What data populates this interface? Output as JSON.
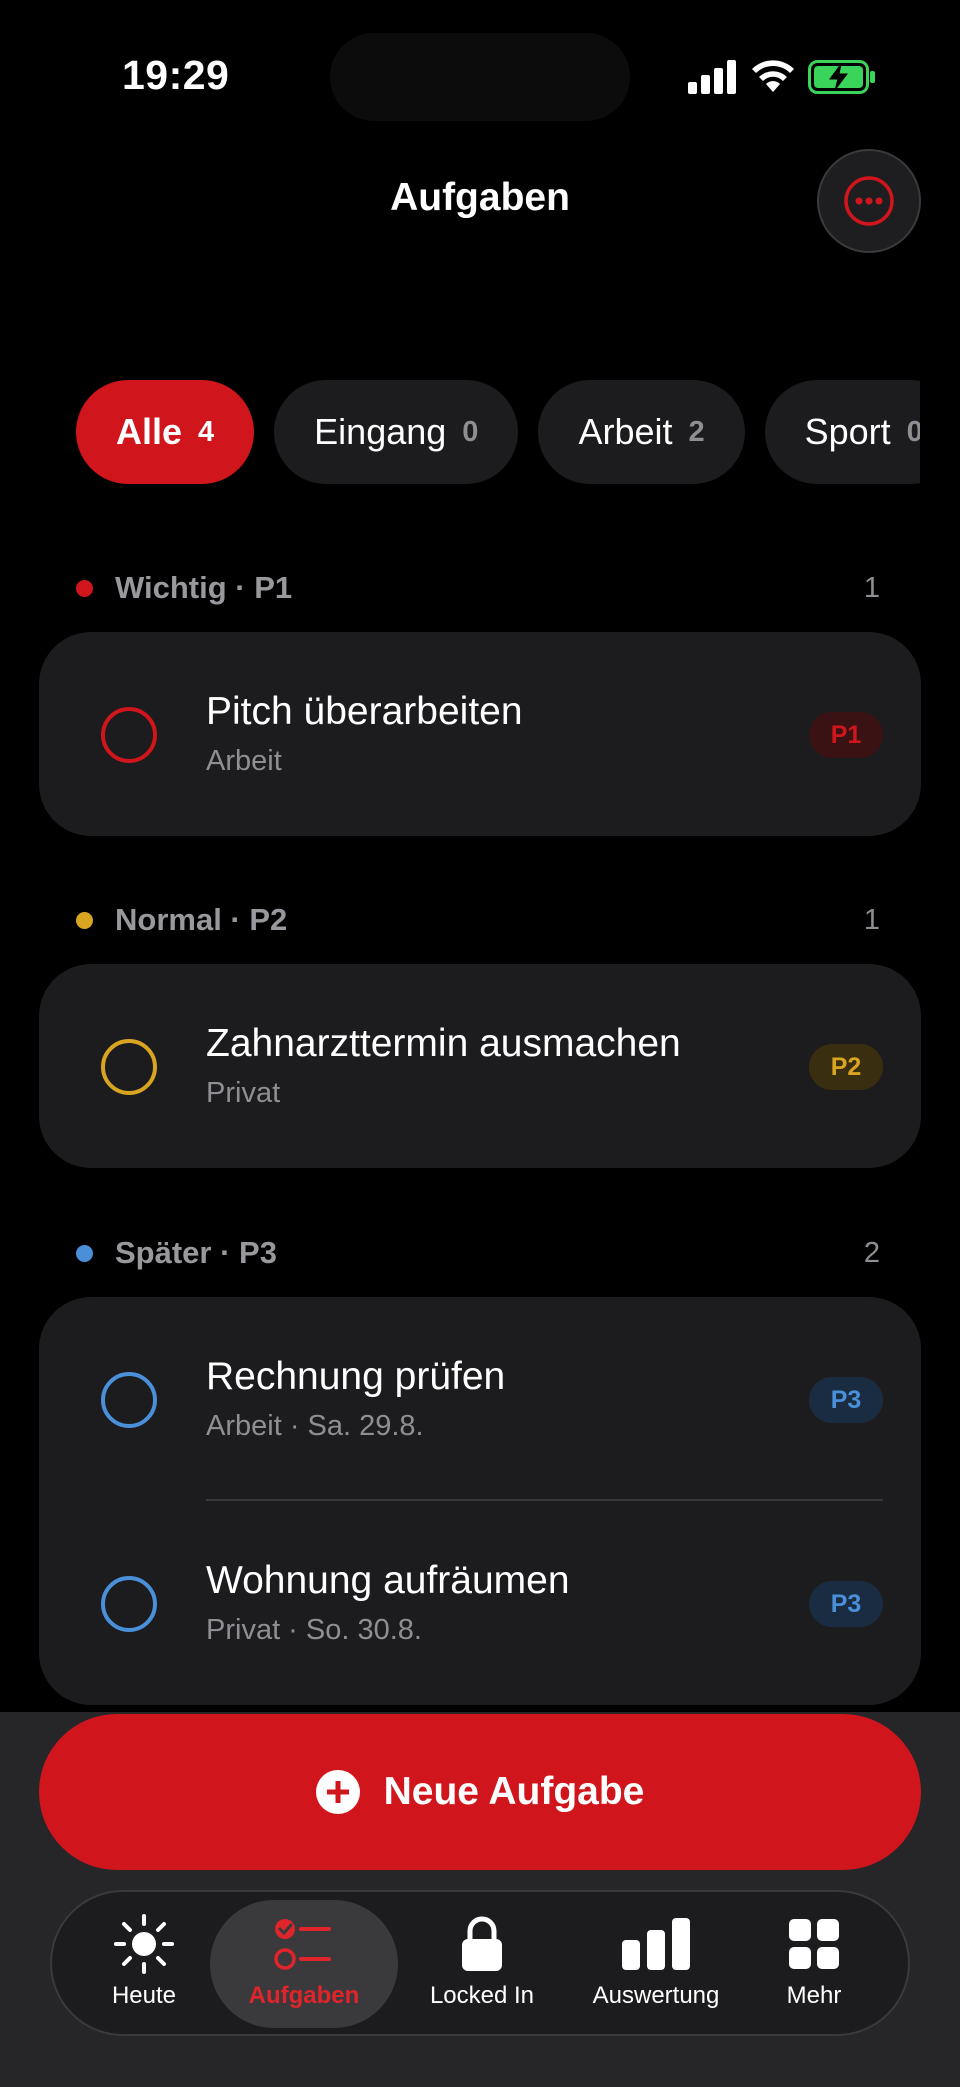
{
  "status": {
    "time": "19:29"
  },
  "header": {
    "title": "Aufgaben"
  },
  "filters": [
    {
      "label": "Alle",
      "count": "4"
    },
    {
      "label": "Eingang",
      "count": "0"
    },
    {
      "label": "Arbeit",
      "count": "2"
    },
    {
      "label": "Sport",
      "count": "0"
    }
  ],
  "sections": [
    {
      "title": "Wichtig · P1",
      "count": "1",
      "color": "#d0161c",
      "tasks": [
        {
          "title": "Pitch überarbeiten",
          "subtitle": "Arbeit",
          "badge": "P1"
        }
      ]
    },
    {
      "title": "Normal · P2",
      "count": "1",
      "color": "#d9a521",
      "tasks": [
        {
          "title": "Zahnarzttermin ausmachen",
          "subtitle": "Privat",
          "badge": "P2"
        }
      ]
    },
    {
      "title": "Später · P3",
      "count": "2",
      "color": "#4a8fd9",
      "tasks": [
        {
          "title": "Rechnung prüfen",
          "subtitle": "Arbeit · Sa. 29.8.",
          "badge": "P3"
        },
        {
          "title": "Wohnung aufräumen",
          "subtitle": "Privat · So. 30.8.",
          "badge": "P3"
        }
      ]
    }
  ],
  "new_task": {
    "label": "Neue Aufgabe"
  },
  "tabs": [
    {
      "label": "Heute",
      "icon": "sun-icon"
    },
    {
      "label": "Aufgaben",
      "icon": "checklist-icon",
      "active": true
    },
    {
      "label": "Locked In",
      "icon": "lock-icon"
    },
    {
      "label": "Auswertung",
      "icon": "bar-chart-icon"
    },
    {
      "label": "Mehr",
      "icon": "grid-icon"
    }
  ],
  "colors": {
    "accent": "#d0161c",
    "p1": "#d0161c",
    "p2": "#d9a521",
    "p3": "#4a8fd9",
    "card": "#1c1c1e"
  }
}
